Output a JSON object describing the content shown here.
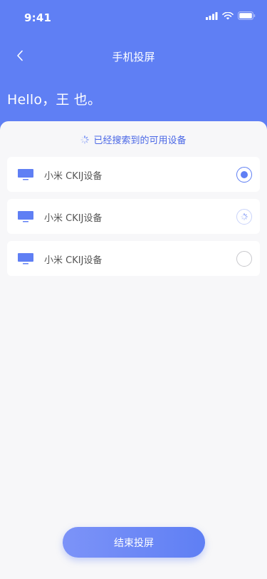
{
  "status_bar": {
    "time": "9:41"
  },
  "nav": {
    "title": "手机投屏"
  },
  "greeting": "Hello，王 也。",
  "search_status": "已经搜索到的可用设备",
  "devices": [
    {
      "name": "小米 CKIJ设备",
      "state": "selected"
    },
    {
      "name": "小米 CKIJ设备",
      "state": "loading"
    },
    {
      "name": "小米 CKIJ设备",
      "state": "unselected"
    }
  ],
  "actions": {
    "end_label": "结束投屏"
  },
  "colors": {
    "primary": "#5f7ff4",
    "background": "#f7f7f9",
    "card": "#ffffff"
  },
  "icons": {
    "back": "chevron-left-icon",
    "device": "monitor-icon",
    "signal": "signal-icon",
    "wifi": "wifi-icon",
    "battery": "battery-icon",
    "spinner": "spinner-icon"
  }
}
